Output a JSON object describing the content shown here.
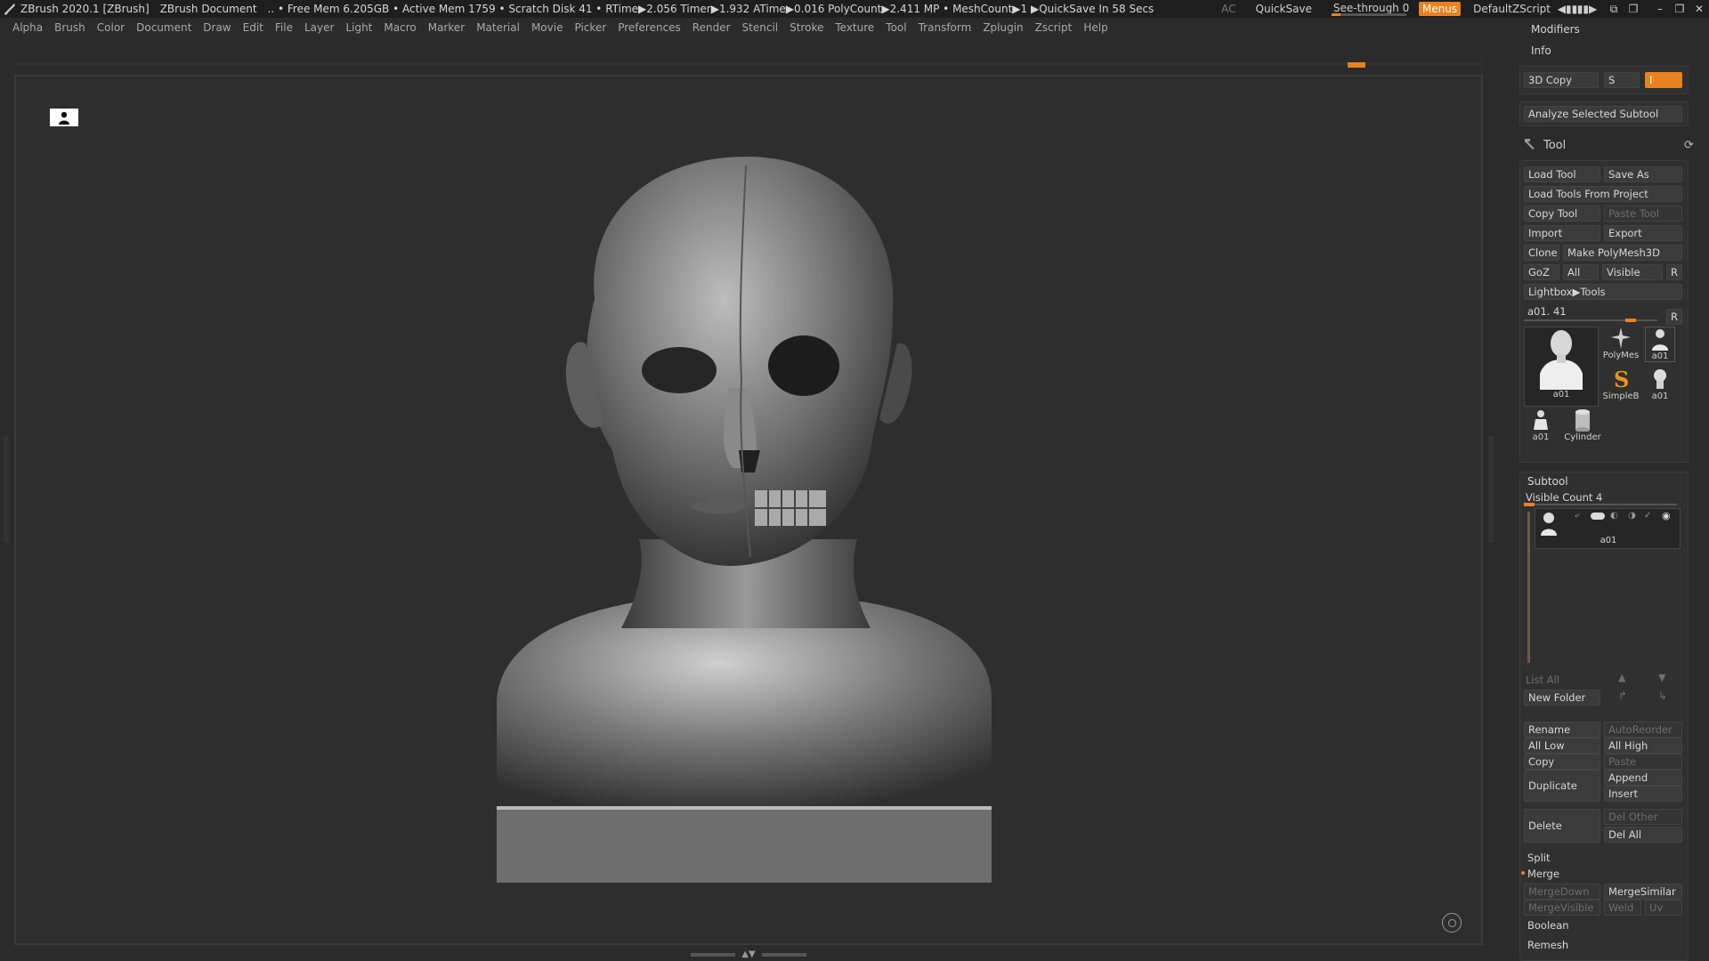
{
  "title_bar": {
    "app": "ZBrush 2020.1 [ZBrush]",
    "document": "ZBrush Document",
    "stats": ".. • Free Mem 6.205GB • Active Mem 1759 • Scratch Disk 41 •  RTime▶2.056 Timer▶1.932 ATime▶0.016 PolyCount▶2.411 MP  • MeshCount▶1  ▶QuickSave In 58 Secs",
    "ac": "AC",
    "quicksave": "QuickSave",
    "see_through": "See-through  0",
    "menus": "Menus",
    "script": "DefaultZScript"
  },
  "menu_bar": [
    "Alpha",
    "Brush",
    "Color",
    "Document",
    "Draw",
    "Edit",
    "File",
    "Layer",
    "Light",
    "Macro",
    "Marker",
    "Material",
    "Movie",
    "Picker",
    "Preferences",
    "Render",
    "Stencil",
    "Stroke",
    "Texture",
    "Tool",
    "Transform",
    "Zplugin",
    "Zscript",
    "Help"
  ],
  "right_panel": {
    "modifiers": "Modifiers",
    "info": "Info",
    "copy3d": "3D Copy",
    "copy3d_s": "S",
    "copy3d_i": "I",
    "analyze": "Analyze Selected Subtool",
    "tool_header": "Tool",
    "load_tool": "Load Tool",
    "save_as": "Save As",
    "load_from_project": "Load Tools From Project",
    "copy_tool": "Copy Tool",
    "paste_tool": "Paste Tool",
    "import": "Import",
    "export": "Export",
    "clone": "Clone",
    "make_polymesh": "Make PolyMesh3D",
    "goz": "GoZ",
    "all": "All",
    "visible": "Visible",
    "r": "R",
    "lightbox_tools": "Lightbox▶Tools",
    "current_tool": "a01. 41",
    "thumbs": {
      "main": "a01",
      "polymesh": "PolyMes",
      "a01_b": "a01",
      "simpleb": "SimpleB",
      "a01_c": "a01",
      "a01_d": "a01",
      "cylinder": "Cylinder"
    },
    "subtool_header": "Subtool",
    "visible_count": "Visible Count 4",
    "subtool_item": "a01",
    "list_all": "List All",
    "new_folder": "New Folder",
    "rename": "Rename",
    "autoreorder": "AutoReorder",
    "all_low": "All Low",
    "all_high": "All High",
    "copy": "Copy",
    "paste": "Paste",
    "duplicate": "Duplicate",
    "append": "Append",
    "insert": "Insert",
    "delete": "Delete",
    "del_other": "Del Other",
    "del_all": "Del All",
    "split": "Split",
    "merge": "Merge",
    "merge_down": "MergeDown",
    "merge_similar": "MergeSimilar",
    "merge_visible": "MergeVisible",
    "weld": "Weld",
    "uv": "Uv",
    "boolean": "Boolean",
    "remesh": "Remesh"
  },
  "colors": {
    "accent": "#e8821e",
    "background": "#2b2b2b",
    "viewport": "#2e2e2e"
  }
}
